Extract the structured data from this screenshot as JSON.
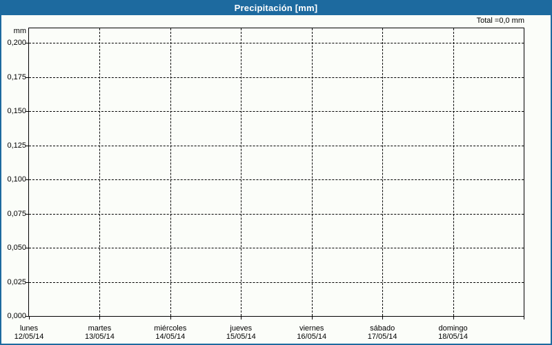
{
  "header": {
    "title": "Precipitación [mm]"
  },
  "chart": {
    "total_label": "Total =0,0 mm",
    "axis_unit_label": "mm"
  },
  "chart_data": {
    "type": "bar",
    "title": "Precipitación [mm]",
    "ylabel": "mm",
    "xlabel": "",
    "ylim": [
      0,
      0.21
    ],
    "grid": "dashed-both-axes",
    "legend": "none",
    "total_annotation": "Total =0,0 mm",
    "yticks": [
      {
        "value": 0.2,
        "label": "0,200"
      },
      {
        "value": 0.175,
        "label": "0,175"
      },
      {
        "value": 0.15,
        "label": "0,150"
      },
      {
        "value": 0.125,
        "label": "0,125"
      },
      {
        "value": 0.1,
        "label": "0,100"
      },
      {
        "value": 0.075,
        "label": "0,075"
      },
      {
        "value": 0.05,
        "label": "0,050"
      },
      {
        "value": 0.025,
        "label": "0,025"
      },
      {
        "value": 0.0,
        "label": "0,000"
      }
    ],
    "categories": [
      {
        "day": "lunes",
        "date": "12/05/14"
      },
      {
        "day": "martes",
        "date": "13/05/14"
      },
      {
        "day": "miércoles",
        "date": "14/05/14"
      },
      {
        "day": "jueves",
        "date": "15/05/14"
      },
      {
        "day": "viernes",
        "date": "16/05/14"
      },
      {
        "day": "sábado",
        "date": "17/05/14"
      },
      {
        "day": "domingo",
        "date": "18/05/14"
      }
    ],
    "values": [
      0,
      0,
      0,
      0,
      0,
      0,
      0
    ]
  },
  "colors": {
    "header_bg": "#1d6a9f",
    "header_text": "#ffffff",
    "frame_border": "#1d6a9f",
    "background": "#fbfdf9",
    "text": "#000000",
    "grid": "#000000",
    "plot_border": "#000000"
  }
}
